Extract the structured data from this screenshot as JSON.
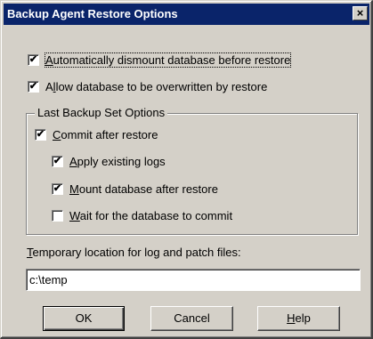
{
  "window": {
    "title": "Backup Agent Restore Options",
    "close_glyph": "×"
  },
  "options": {
    "auto_dismount": {
      "checked": true,
      "pre": "",
      "mnemonic": "A",
      "rest": "utomatically dismount database before restore"
    },
    "allow_overwrite": {
      "checked": true,
      "pre": "A",
      "mnemonic": "l",
      "rest": "low database to be overwritten by restore"
    }
  },
  "last_backup_group": {
    "legend": "Last Backup Set Options",
    "commit_after_restore": {
      "checked": true,
      "pre": "",
      "mnemonic": "C",
      "rest": "ommit after restore"
    },
    "apply_existing_logs": {
      "checked": true,
      "pre": "",
      "mnemonic": "A",
      "rest": "pply existing logs"
    },
    "mount_after_restore": {
      "checked": true,
      "pre": "",
      "mnemonic": "M",
      "rest": "ount database after restore"
    },
    "wait_for_commit": {
      "checked": false,
      "pre": "",
      "mnemonic": "W",
      "rest": "ait for the database to commit"
    }
  },
  "temp_location": {
    "label_mnemonic": "T",
    "label_rest": "emporary location for log and patch files:",
    "value": "c:\\temp"
  },
  "buttons": {
    "ok": {
      "pre": "",
      "mnemonic": "",
      "rest": "OK"
    },
    "cancel": {
      "pre": "",
      "mnemonic": "",
      "rest": "Cancel"
    },
    "help": {
      "pre": "",
      "mnemonic": "H",
      "rest": "elp"
    }
  },
  "check_glyph": "✔"
}
